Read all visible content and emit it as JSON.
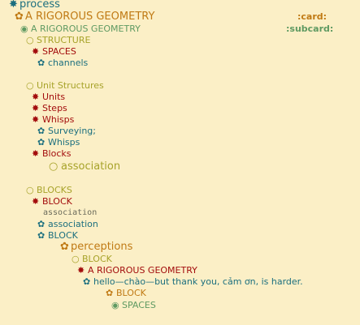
{
  "outline": {
    "process": {
      "bullet": "✸",
      "text": "process"
    },
    "rigorous_geometry": {
      "bullet": "✿",
      "text": "A RIGOROUS GEOMETRY",
      "tag": ":card:"
    },
    "rigorous_geometry_sub": {
      "bullet": "◉",
      "text": "A RIGOROUS GEOMETRY",
      "tag": ":subcard:"
    },
    "structure": {
      "bullet": "○",
      "text": "STRUCTURE"
    },
    "spaces": {
      "bullet": "✸",
      "text": "SPACES"
    },
    "channels": {
      "bullet": "✿",
      "text": "channels"
    },
    "unit_structures": {
      "bullet": "○",
      "text": "Unit Structures"
    },
    "units": {
      "bullet": "✸",
      "text": "Units"
    },
    "steps": {
      "bullet": "✸",
      "text": "Steps"
    },
    "whisps": {
      "bullet": "✸",
      "text": "Whisps"
    },
    "surveying": {
      "bullet": "✿",
      "text": "Surveying;"
    },
    "whisps_sub": {
      "bullet": "✿",
      "text": "Whisps"
    },
    "blocks_item": {
      "bullet": "✸",
      "text": "Blocks"
    },
    "association_big": {
      "bullet": "○",
      "text": "association"
    },
    "blocks_heading": {
      "bullet": "○",
      "text": "BLOCKS"
    },
    "block": {
      "bullet": "✸",
      "text": "BLOCK"
    },
    "association_plain": {
      "text": "association"
    },
    "association_link": {
      "bullet": "✿",
      "text": "association"
    },
    "block_sub": {
      "bullet": "✿",
      "text": "BLOCK"
    },
    "perceptions": {
      "bullet": "✿",
      "text": "perceptions"
    },
    "block_deep": {
      "bullet": "○",
      "text": "BLOCK"
    },
    "rigorous_geometry_deep": {
      "bullet": "✸",
      "text": "A RIGOROUS GEOMETRY"
    },
    "hello": {
      "bullet": "✿",
      "text": "hello—chào—but thank you, cảm ơn, is harder."
    },
    "block_deeper": {
      "bullet": "✿",
      "text": "BLOCK"
    },
    "spaces_deep": {
      "bullet": "◉",
      "text": "SPACES"
    }
  }
}
